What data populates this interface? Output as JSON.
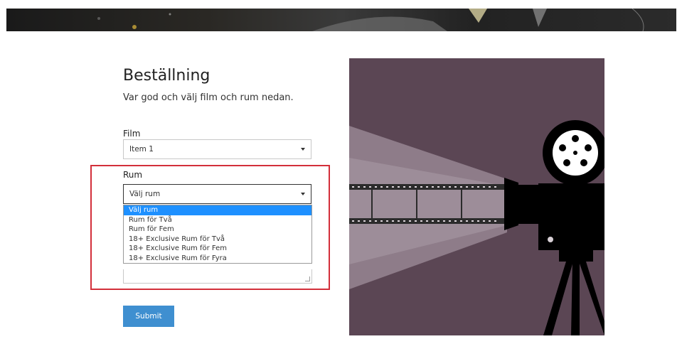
{
  "form": {
    "title": "Beställning",
    "subtitle": "Var god och välj film och rum nedan.",
    "film_label": "Film",
    "film_value": "Item 1",
    "room_label": "Rum",
    "room_value": "Välj rum",
    "room_options": [
      "Välj rum",
      "Rum för Två",
      "Rum för Fem",
      "18+ Exclusive Rum för Två",
      "18+ Exclusive Rum för Fem",
      "18+ Exclusive Rum för Fyra"
    ],
    "submit_label": "Submit"
  },
  "colors": {
    "accent": "#3f8fd0",
    "highlight": "#d32f3a",
    "selected_option": "#1e90ff",
    "illustration_bg": "#5b4654"
  },
  "icons": {
    "caret": "chevron-down-icon",
    "projector": "film-projector-icon"
  }
}
